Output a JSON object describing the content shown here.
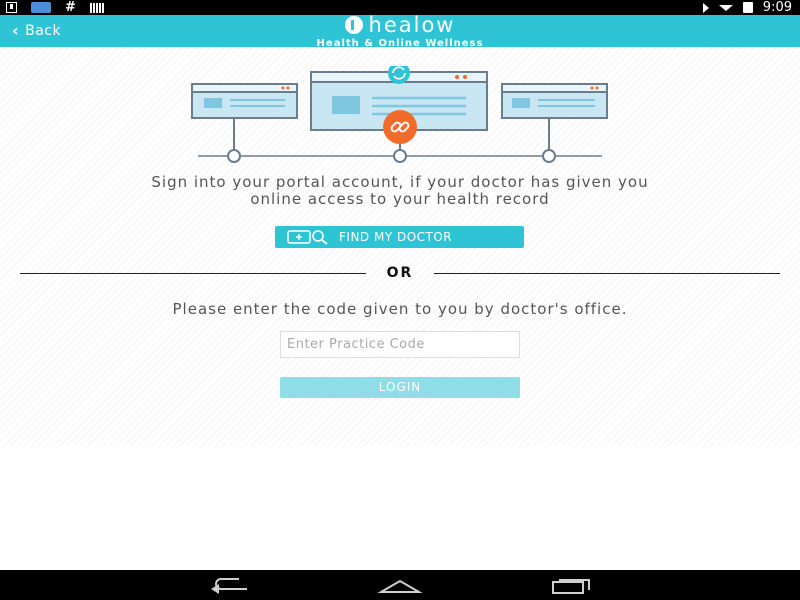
{
  "status_bar": {
    "time": "9:09",
    "icons": [
      "download-icon",
      "app-notification-icon",
      "hash-icon",
      "barcode-icon",
      "mute-icon",
      "wifi-icon",
      "battery-icon"
    ]
  },
  "header": {
    "back_label": "Back",
    "brand_name": "healow",
    "tagline": "Health & Online Wellness",
    "background_color": "#2ec4d6"
  },
  "main": {
    "sign_in_text_line1": "Sign into your portal account, if your doctor has given you",
    "sign_in_text_line2": "online access to your health record",
    "find_doctor_label": "FIND MY DOCTOR",
    "or_label": "OR",
    "code_prompt": "Please enter the code given to you by doctor's office.",
    "practice_code_placeholder": "Enter Practice Code",
    "practice_code_value": "",
    "login_label": "LOGIN",
    "accent_color": "#2ec4d6",
    "link_icon_color": "#f26b2b"
  },
  "nav_bar": {
    "buttons": [
      "back-nav-icon",
      "home-nav-icon",
      "recents-nav-icon"
    ]
  }
}
